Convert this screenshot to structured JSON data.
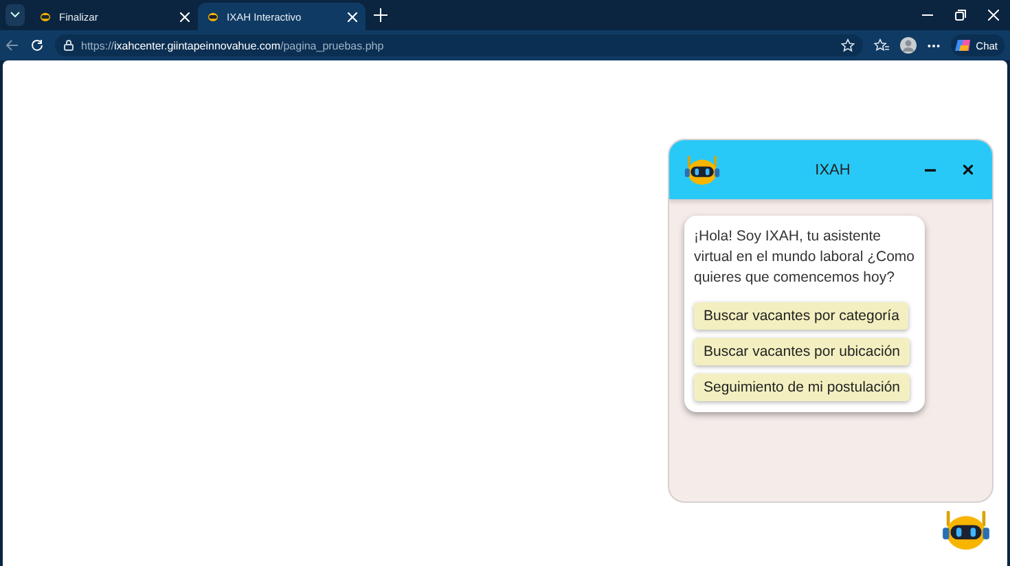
{
  "browser": {
    "tabs": [
      {
        "title": "Finalizar",
        "selected": false
      },
      {
        "title": "IXAH Interactivo",
        "selected": true
      }
    ],
    "address": {
      "scheme": "https://",
      "host": "ixahcenter.giintapeinnovahue.com",
      "path": "/pagina_pruebas.php"
    },
    "chat_button": "Chat"
  },
  "chat": {
    "title": "IXAH",
    "message": "¡Hola! Soy IXAH, tu asistente virtual en el mundo laboral ¿Como quieres que comencemos hoy?",
    "options": [
      "Buscar vacantes por categoría",
      "Buscar vacantes por ubicación",
      "Seguimiento de mi postulación"
    ]
  }
}
